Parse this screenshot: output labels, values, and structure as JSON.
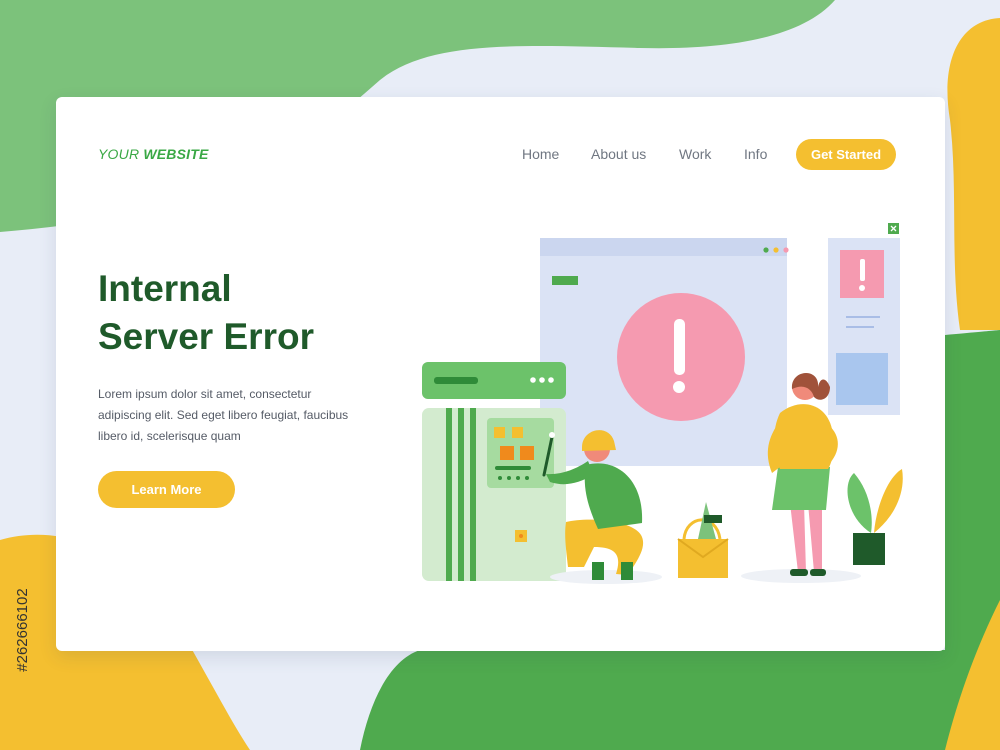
{
  "header": {
    "logo_prefix": "YOUR ",
    "logo_bold": "WEBSITE",
    "nav": [
      "Home",
      "About us",
      "Work",
      "Info"
    ],
    "cta_label": "Get Started"
  },
  "hero": {
    "headline_line1": "Internal",
    "headline_line2": "Server Error",
    "body": "Lorem ipsum dolor sit amet, consectetur adipiscing elit. Sed eget libero feugiat, faucibus libero id, scelerisque quam",
    "button_label": "Learn More"
  },
  "side_code": "#262666102",
  "colors": {
    "brand_green": "#3aa845",
    "headline_green": "#1f5a2a",
    "accent_yellow": "#f4bf30",
    "alert_pink": "#f59ab0",
    "page_bg": "#e8edf7"
  },
  "icons": [
    "exclamation-icon",
    "close-icon",
    "window-dots-icon"
  ]
}
